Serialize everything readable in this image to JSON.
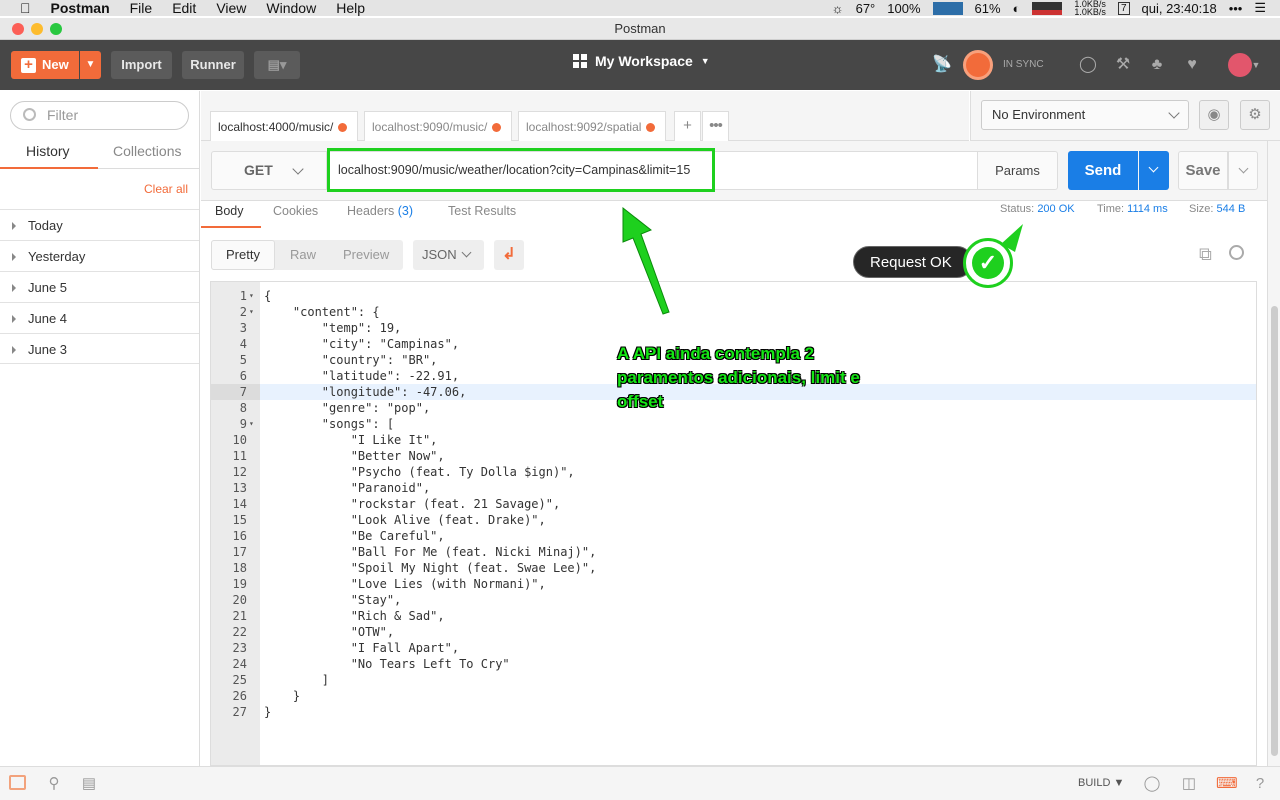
{
  "menubar": {
    "app": "Postman",
    "items": [
      "File",
      "Edit",
      "View",
      "Window",
      "Help"
    ],
    "status": {
      "temp": "67°",
      "battery": "100%",
      "cpu": "61%",
      "net_up": "1.0KB/s",
      "net_down": "1.0KB/s",
      "date": "7",
      "clock": "qui, 23:40:18"
    }
  },
  "window": {
    "title": "Postman"
  },
  "header": {
    "new_label": "New",
    "import_label": "Import",
    "runner_label": "Runner",
    "workspace_label": "My Workspace",
    "sync_label": "IN SYNC"
  },
  "sidebar": {
    "filter_placeholder": "Filter",
    "tabs": [
      {
        "label": "History"
      },
      {
        "label": "Collections"
      }
    ],
    "clear_all": "Clear all",
    "groups": [
      {
        "label": "Today"
      },
      {
        "label": "Yesterday"
      },
      {
        "label": "June 5"
      },
      {
        "label": "June 4"
      },
      {
        "label": "June 3"
      }
    ]
  },
  "request_tabs": [
    {
      "label": "localhost:4000/music/"
    },
    {
      "label": "localhost:9090/music/"
    },
    {
      "label": "localhost:9092/spatial"
    }
  ],
  "environment": {
    "selected": "No Environment"
  },
  "request": {
    "method": "GET",
    "url": "localhost:9090/music/weather/location?city=Campinas&limit=15",
    "params_label": "Params",
    "send_label": "Send",
    "save_label": "Save"
  },
  "response_tabs": {
    "body": "Body",
    "cookies": "Cookies",
    "headers": "Headers",
    "headers_count": "(3)",
    "tests": "Test Results"
  },
  "response_meta": {
    "status_label": "Status:",
    "status_value": "200 OK",
    "time_label": "Time:",
    "time_value": "1114 ms",
    "size_label": "Size:",
    "size_value": "544 B"
  },
  "view": {
    "modes": [
      "Pretty",
      "Raw",
      "Preview"
    ],
    "format": "JSON"
  },
  "code_lines": [
    "{",
    "    \"content\": {",
    "        \"temp\": 19,",
    "        \"city\": \"Campinas\",",
    "        \"country\": \"BR\",",
    "        \"latitude\": -22.91,",
    "        \"longitude\": -47.06,",
    "        \"genre\": \"pop\",",
    "        \"songs\": [",
    "            \"I Like It\",",
    "            \"Better Now\",",
    "            \"Psycho (feat. Ty Dolla $ign)\",",
    "            \"Paranoid\",",
    "            \"rockstar (feat. 21 Savage)\",",
    "            \"Look Alive (feat. Drake)\",",
    "            \"Be Careful\",",
    "            \"Ball For Me (feat. Nicki Minaj)\",",
    "            \"Spoil My Night (feat. Swae Lee)\",",
    "            \"Love Lies (with Normani)\",",
    "            \"Stay\",",
    "            \"Rich & Sad\",",
    "            \"OTW\",",
    "            \"I Fall Apart\",",
    "            \"No Tears Left To Cry\"",
    "        ]",
    "    }",
    "}"
  ],
  "annotations": {
    "note": "A API ainda contempla 2 paramentos adicionais, limit e offset",
    "badge": "Request OK"
  },
  "statusbar": {
    "build_label": "BUILD"
  },
  "colors": {
    "accent": "#f26b3a",
    "send": "#1a7ee6",
    "annotation": "#1ed01e"
  }
}
